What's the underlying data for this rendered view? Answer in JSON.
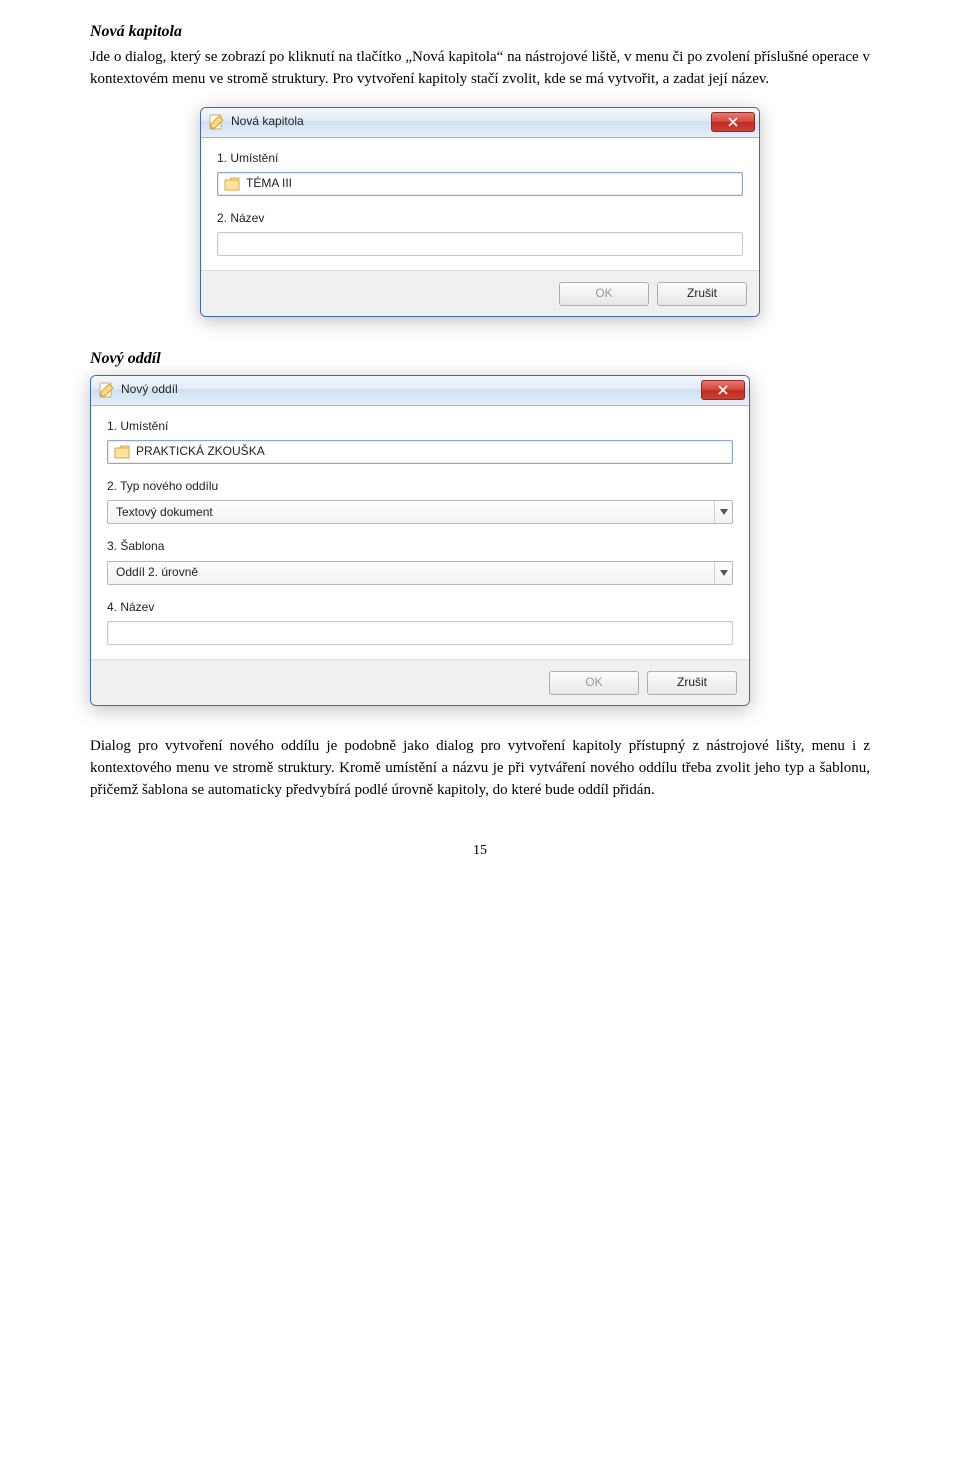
{
  "section1": {
    "heading": "Nová kapitola",
    "paragraph": "Jde o dialog, který se zobrazí po kliknutí na tlačítko „Nová kapitola“ na nástrojové liště, v menu či po zvolení příslušné operace v kontextovém menu ve stromě struktury. Pro vytvoření kapitoly stačí zvolit, kde se má vytvořit, a zadat její název."
  },
  "dialog1": {
    "title": "Nová kapitola",
    "blur_text": "",
    "labels": {
      "l1": "1. Umístění",
      "l2": "2. Název"
    },
    "location_value": "TÉMA III",
    "name_value": "",
    "buttons": {
      "ok": "OK",
      "cancel": "Zrušit"
    }
  },
  "section2": {
    "heading": "Nový oddíl",
    "paragraph": "Dialog pro vytvoření nového oddílu je podobně jako dialog pro vytvoření kapitoly přístupný z nástrojové lišty, menu i z kontextového menu ve stromě struktury. Kromě umístění a názvu je při vytváření nového oddílu třeba zvolit jeho typ a šablonu, přičemž šablona se automaticky předvybírá podlé úrovně kapitoly, do které bude oddíl přidán."
  },
  "dialog2": {
    "title": "Nový oddíl",
    "blur_text": "",
    "labels": {
      "l1": "1. Umístění",
      "l2": "2. Typ nového oddílu",
      "l3": "3. Šablona",
      "l4": "4. Název"
    },
    "location_value": "PRAKTICKÁ ZKOUŠKA",
    "type_value": "Textový dokument",
    "template_value": "Oddíl 2. úrovně",
    "name_value": "",
    "buttons": {
      "ok": "OK",
      "cancel": "Zrušit"
    }
  },
  "page_number": "15"
}
